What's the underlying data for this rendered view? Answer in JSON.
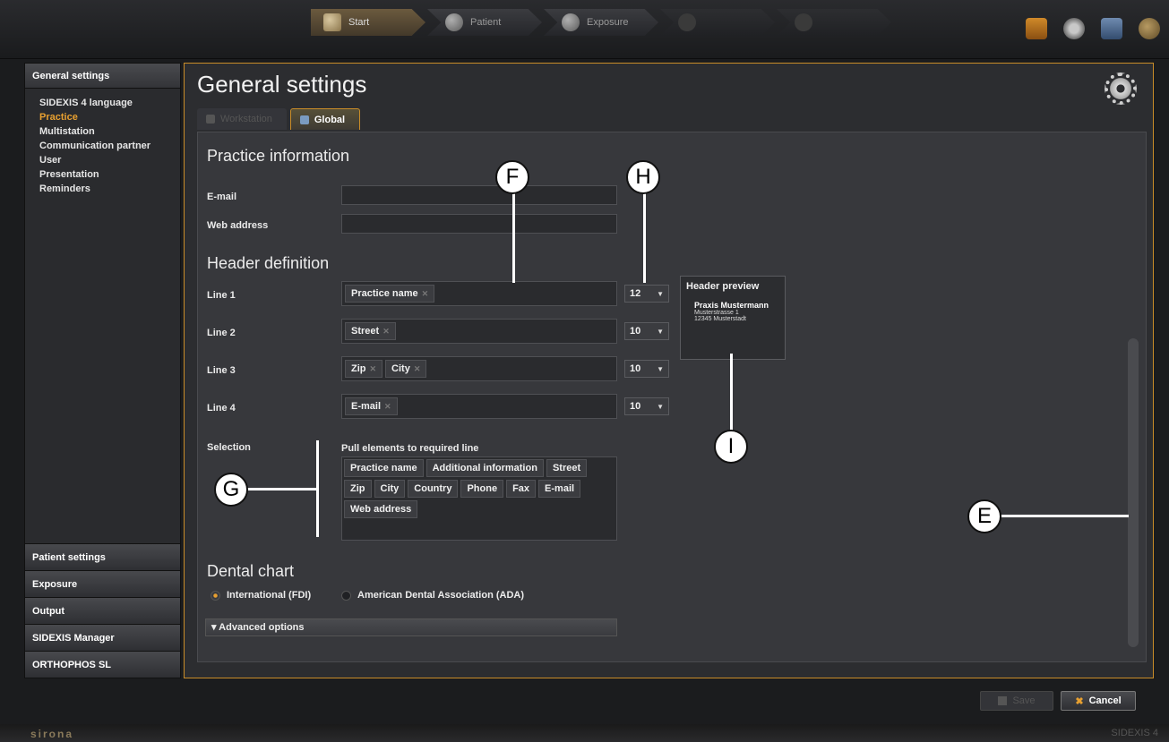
{
  "workflow": {
    "steps": [
      {
        "label": "Start",
        "icon": "start-icon"
      },
      {
        "label": "Patient",
        "icon": "patient-icon"
      },
      {
        "label": "Exposure",
        "icon": "exposure-icon"
      },
      {
        "label": "",
        "icon": "examine-icon"
      },
      {
        "label": "",
        "icon": "output-icon"
      }
    ]
  },
  "top_icons": [
    "book-icon",
    "gear-icon",
    "monitor-icon",
    "globe-icon"
  ],
  "sidebar": {
    "header": "General settings",
    "items": [
      "SIDEXIS 4 language",
      "Practice",
      "Multistation",
      "Communication partner",
      "User",
      "Presentation",
      "Reminders"
    ],
    "active_item": "Practice",
    "sections": [
      "Patient settings",
      "Exposure",
      "Output",
      "SIDEXIS Manager",
      "ORTHOPHOS SL"
    ]
  },
  "main": {
    "title": "General settings",
    "tabs": [
      {
        "label": "Workstation",
        "active": false
      },
      {
        "label": "Global",
        "active": true
      }
    ]
  },
  "practice": {
    "title": "Practice information",
    "email_label": "E-mail",
    "web_label": "Web address",
    "email_value": "",
    "web_value": ""
  },
  "header_def": {
    "title": "Header definition",
    "lines": [
      {
        "label": "Line 1",
        "chips": [
          "Practice name"
        ],
        "size": "12"
      },
      {
        "label": "Line 2",
        "chips": [
          "Street"
        ],
        "size": "10"
      },
      {
        "label": "Line 3",
        "chips": [
          "Zip",
          "City"
        ],
        "size": "10"
      },
      {
        "label": "Line 4",
        "chips": [
          "E-mail"
        ],
        "size": "10"
      }
    ],
    "preview": {
      "title": "Header preview",
      "line1": "Praxis Mustermann",
      "line2": "Musterstrasse 1",
      "line3": "12345 Musterstadt"
    }
  },
  "selection": {
    "label": "Selection",
    "instruction": "Pull elements to required line",
    "rows": [
      [
        "Practice name",
        "Additional information",
        "Street"
      ],
      [
        "Zip",
        "City",
        "Country",
        "Phone",
        "Fax",
        "E-mail"
      ],
      [
        "Web address"
      ]
    ]
  },
  "dental_chart": {
    "title": "Dental chart",
    "options": [
      {
        "label": "International (FDI)",
        "selected": true
      },
      {
        "label": "American Dental Association (ADA)",
        "selected": false
      }
    ],
    "advanced_label": "Advanced options"
  },
  "callouts": [
    "F",
    "H",
    "I",
    "G",
    "E"
  ],
  "footer": {
    "save_label": "Save",
    "cancel_label": "Cancel",
    "brand": "sirona",
    "version": "SIDEXIS 4"
  },
  "colors": {
    "accent": "#e8a030",
    "border_accent": "#c98c28"
  }
}
